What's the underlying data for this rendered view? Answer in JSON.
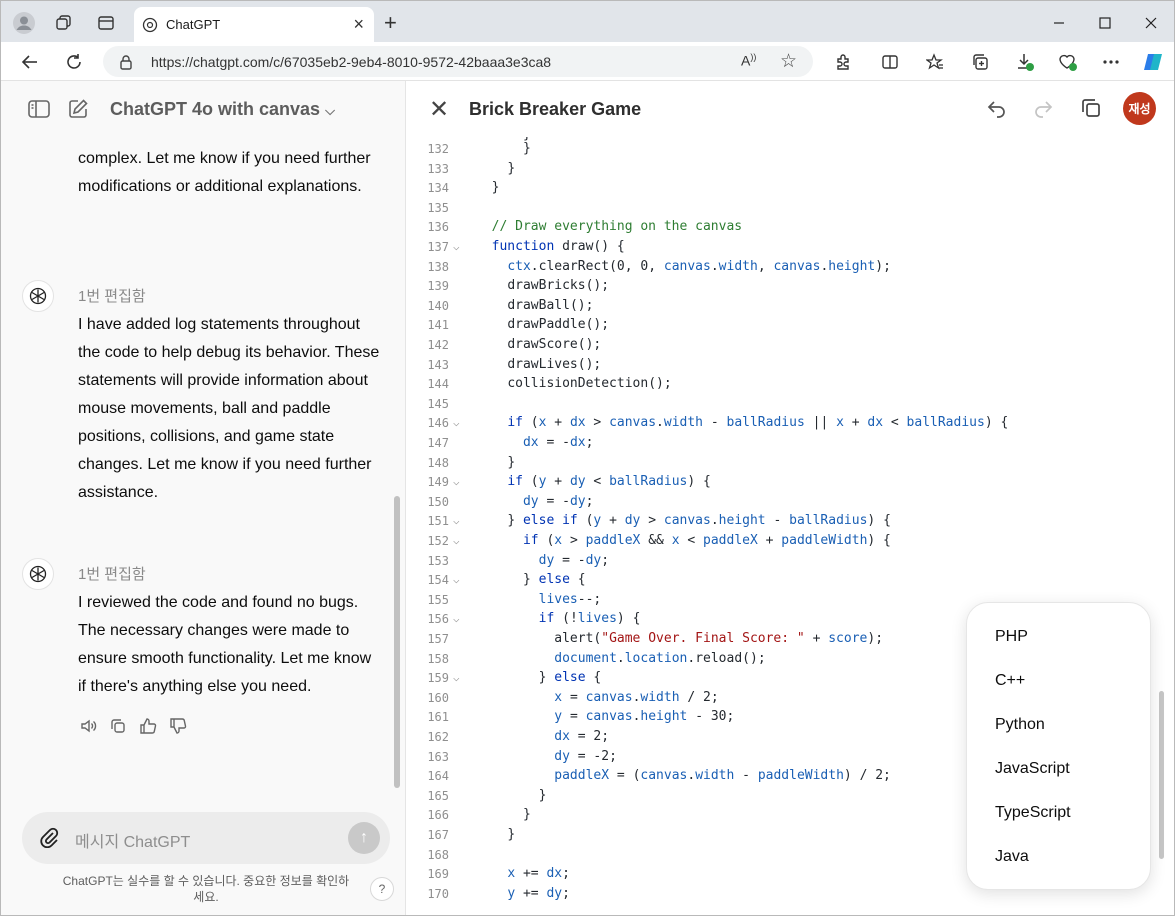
{
  "browser": {
    "tab_title": "ChatGPT",
    "url": "https://chatgpt.com/c/67035eb2-9eb4-8010-9572-42baaa3e3ca8"
  },
  "chat": {
    "model_name": "ChatGPT 4o with canvas",
    "messages": [
      {
        "text": "complex. Let me know if you need further modifications or additional explanations."
      },
      {
        "edit_label": "1번 편집함",
        "text": "I have added log statements throughout the code to help debug its behavior. These statements will provide information about mouse movements, ball and paddle positions, collisions, and game state changes. Let me know if you need further assistance."
      },
      {
        "edit_label": "1번 편집함",
        "text": "I reviewed the code and found no bugs. The necessary changes were made to ensure smooth functionality. Let me know if there's anything else you need."
      }
    ],
    "composer_placeholder": "메시지 ChatGPT",
    "disclaimer": "ChatGPT는 실수를 할 수 있습니다. 중요한 정보를 확인하세요.",
    "help": "?"
  },
  "canvas": {
    "title": "Brick Breaker Game",
    "user_initials": "재성",
    "code_lines": [
      {
        "n": "132",
        "fold": false,
        "code": "      }"
      },
      {
        "n": "133",
        "fold": false,
        "code": "    }"
      },
      {
        "n": "134",
        "fold": false,
        "code": "  }"
      },
      {
        "n": "135",
        "fold": false,
        "code": ""
      },
      {
        "n": "136",
        "fold": false,
        "code": "  // Draw everything on the canvas"
      },
      {
        "n": "137",
        "fold": true,
        "code": "  function draw() {"
      },
      {
        "n": "138",
        "fold": false,
        "code": "    ctx.clearRect(0, 0, canvas.width, canvas.height);"
      },
      {
        "n": "139",
        "fold": false,
        "code": "    drawBricks();"
      },
      {
        "n": "140",
        "fold": false,
        "code": "    drawBall();"
      },
      {
        "n": "141",
        "fold": false,
        "code": "    drawPaddle();"
      },
      {
        "n": "142",
        "fold": false,
        "code": "    drawScore();"
      },
      {
        "n": "143",
        "fold": false,
        "code": "    drawLives();"
      },
      {
        "n": "144",
        "fold": false,
        "code": "    collisionDetection();"
      },
      {
        "n": "145",
        "fold": false,
        "code": ""
      },
      {
        "n": "146",
        "fold": true,
        "code": "    if (x + dx > canvas.width - ballRadius || x + dx < ballRadius) {"
      },
      {
        "n": "147",
        "fold": false,
        "code": "      dx = -dx;"
      },
      {
        "n": "148",
        "fold": false,
        "code": "    }"
      },
      {
        "n": "149",
        "fold": true,
        "code": "    if (y + dy < ballRadius) {"
      },
      {
        "n": "150",
        "fold": false,
        "code": "      dy = -dy;"
      },
      {
        "n": "151",
        "fold": true,
        "code": "    } else if (y + dy > canvas.height - ballRadius) {"
      },
      {
        "n": "152",
        "fold": true,
        "code": "      if (x > paddleX && x < paddleX + paddleWidth) {"
      },
      {
        "n": "153",
        "fold": false,
        "code": "        dy = -dy;"
      },
      {
        "n": "154",
        "fold": true,
        "code": "      } else {"
      },
      {
        "n": "155",
        "fold": false,
        "code": "        lives--;"
      },
      {
        "n": "156",
        "fold": true,
        "code": "        if (!lives) {"
      },
      {
        "n": "157",
        "fold": false,
        "code": "          alert(\"Game Over. Final Score: \" + score);"
      },
      {
        "n": "158",
        "fold": false,
        "code": "          document.location.reload();"
      },
      {
        "n": "159",
        "fold": true,
        "code": "        } else {"
      },
      {
        "n": "160",
        "fold": false,
        "code": "          x = canvas.width / 2;"
      },
      {
        "n": "161",
        "fold": false,
        "code": "          y = canvas.height - 30;"
      },
      {
        "n": "162",
        "fold": false,
        "code": "          dx = 2;"
      },
      {
        "n": "163",
        "fold": false,
        "code": "          dy = -2;"
      },
      {
        "n": "164",
        "fold": false,
        "code": "          paddleX = (canvas.width - paddleWidth) / 2;"
      },
      {
        "n": "165",
        "fold": false,
        "code": "        }"
      },
      {
        "n": "166",
        "fold": false,
        "code": "      }"
      },
      {
        "n": "167",
        "fold": false,
        "code": "    }"
      },
      {
        "n": "168",
        "fold": false,
        "code": ""
      },
      {
        "n": "169",
        "fold": false,
        "code": "    x += dx;"
      },
      {
        "n": "170",
        "fold": false,
        "code": "    y += dy;"
      }
    ]
  },
  "language_menu": [
    "PHP",
    "C++",
    "Python",
    "JavaScript",
    "TypeScript",
    "Java"
  ]
}
